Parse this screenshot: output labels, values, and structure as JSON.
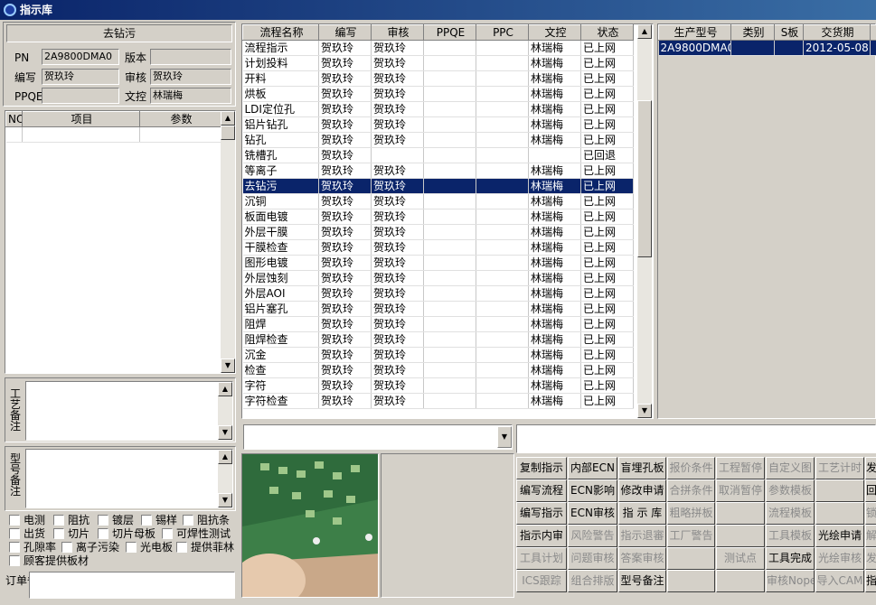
{
  "window": {
    "title": "指示库"
  },
  "header": {
    "process_name": "去钻污",
    "pn_label": "PN",
    "pn_value": "2A9800DMA0",
    "version_label": "版本",
    "version_value": "",
    "editor_label": "编写",
    "editor_value": "贺玖玲",
    "reviewer_label": "审核",
    "reviewer_value": "贺玖玲",
    "ppqe_label": "PPQE",
    "ppqe_value": "",
    "doc_label": "文控",
    "doc_value": "林瑞梅"
  },
  "param_table": {
    "columns": [
      "NO",
      "项目",
      "参数"
    ]
  },
  "notes": {
    "craft_label": "工艺备注",
    "model_label": "型号备注",
    "order_label": "订单备注"
  },
  "checkboxes": [
    [
      "电测",
      "阻抗",
      "镀层",
      "锡样",
      "阻抗条"
    ],
    [
      "出货",
      "切片",
      "切片母板",
      "可焊性测试"
    ],
    [
      "孔隙率",
      "离子污染",
      "光电板",
      "提供菲林"
    ],
    [
      "顾客提供板材"
    ]
  ],
  "process_table": {
    "columns": [
      "流程名称",
      "编写",
      "审核",
      "PPQE",
      "PPC",
      "文控",
      "状态"
    ],
    "selected_index": 9,
    "rows": [
      [
        "流程指示",
        "贺玖玲",
        "贺玖玲",
        "",
        "",
        "林瑞梅",
        "已上网"
      ],
      [
        "计划投料",
        "贺玖玲",
        "贺玖玲",
        "",
        "",
        "林瑞梅",
        "已上网"
      ],
      [
        "开料",
        "贺玖玲",
        "贺玖玲",
        "",
        "",
        "林瑞梅",
        "已上网"
      ],
      [
        "烘板",
        "贺玖玲",
        "贺玖玲",
        "",
        "",
        "林瑞梅",
        "已上网"
      ],
      [
        "LDI定位孔",
        "贺玖玲",
        "贺玖玲",
        "",
        "",
        "林瑞梅",
        "已上网"
      ],
      [
        "铝片钻孔",
        "贺玖玲",
        "贺玖玲",
        "",
        "",
        "林瑞梅",
        "已上网"
      ],
      [
        "钻孔",
        "贺玖玲",
        "贺玖玲",
        "",
        "",
        "林瑞梅",
        "已上网"
      ],
      [
        "铣槽孔",
        "贺玖玲",
        "",
        "",
        "",
        "",
        "已回退"
      ],
      [
        "等离子",
        "贺玖玲",
        "贺玖玲",
        "",
        "",
        "林瑞梅",
        "已上网"
      ],
      [
        "去钻污",
        "贺玖玲",
        "贺玖玲",
        "",
        "",
        "林瑞梅",
        "已上网"
      ],
      [
        "沉铜",
        "贺玖玲",
        "贺玖玲",
        "",
        "",
        "林瑞梅",
        "已上网"
      ],
      [
        "板面电镀",
        "贺玖玲",
        "贺玖玲",
        "",
        "",
        "林瑞梅",
        "已上网"
      ],
      [
        "外层干膜",
        "贺玖玲",
        "贺玖玲",
        "",
        "",
        "林瑞梅",
        "已上网"
      ],
      [
        "干膜检查",
        "贺玖玲",
        "贺玖玲",
        "",
        "",
        "林瑞梅",
        "已上网"
      ],
      [
        "图形电镀",
        "贺玖玲",
        "贺玖玲",
        "",
        "",
        "林瑞梅",
        "已上网"
      ],
      [
        "外层蚀刻",
        "贺玖玲",
        "贺玖玲",
        "",
        "",
        "林瑞梅",
        "已上网"
      ],
      [
        "外层AOI",
        "贺玖玲",
        "贺玖玲",
        "",
        "",
        "林瑞梅",
        "已上网"
      ],
      [
        "铝片塞孔",
        "贺玖玲",
        "贺玖玲",
        "",
        "",
        "林瑞梅",
        "已上网"
      ],
      [
        "阻焊",
        "贺玖玲",
        "贺玖玲",
        "",
        "",
        "林瑞梅",
        "已上网"
      ],
      [
        "阻焊检查",
        "贺玖玲",
        "贺玖玲",
        "",
        "",
        "林瑞梅",
        "已上网"
      ],
      [
        "沉金",
        "贺玖玲",
        "贺玖玲",
        "",
        "",
        "林瑞梅",
        "已上网"
      ],
      [
        "检查",
        "贺玖玲",
        "贺玖玲",
        "",
        "",
        "林瑞梅",
        "已上网"
      ],
      [
        "字符",
        "贺玖玲",
        "贺玖玲",
        "",
        "",
        "林瑞梅",
        "已上网"
      ],
      [
        "字符检查",
        "贺玖玲",
        "贺玖玲",
        "",
        "",
        "林瑞梅",
        "已上网"
      ]
    ]
  },
  "product_table": {
    "columns": [
      "生产型号",
      "类别",
      "S板",
      "交货期",
      "客"
    ],
    "rows": [
      [
        "2A9800DMA0",
        "",
        "",
        "2012-05-08",
        ""
      ]
    ]
  },
  "buttons": [
    [
      "复制指示",
      "内部ECN",
      "盲埋孔板",
      "报价条件",
      "工程暂停",
      "自定义图",
      "工艺计时",
      "发"
    ],
    [
      "编写流程",
      "ECN影响",
      "修改申请",
      "合拼条件",
      "取消暂停",
      "参数模板",
      "",
      "回"
    ],
    [
      "编写指示",
      "ECN审核",
      "指 示 库",
      "粗略拼板",
      "",
      "流程模板",
      "",
      "锁"
    ],
    [
      "指示内审",
      "风险警告",
      "指示退審",
      "工厂警告",
      "",
      "工具模板",
      "光绘申请",
      "解"
    ],
    [
      "工具计划",
      "问题审核",
      "答案审核",
      "",
      "测试点",
      "工具完成",
      "光绘审核",
      "发"
    ],
    [
      "ICS跟踪",
      "组合排版",
      "型号备注",
      "",
      "",
      "审核Nope",
      "导入CAM",
      "指"
    ]
  ],
  "buttons_disabled": [
    [
      false,
      false,
      false,
      true,
      true,
      true,
      true,
      false
    ],
    [
      false,
      false,
      false,
      true,
      true,
      true,
      true,
      false
    ],
    [
      false,
      false,
      false,
      true,
      true,
      true,
      true,
      true
    ],
    [
      false,
      true,
      true,
      true,
      true,
      true,
      false,
      true
    ],
    [
      true,
      true,
      true,
      true,
      true,
      false,
      true,
      true
    ],
    [
      true,
      true,
      false,
      true,
      true,
      true,
      true,
      false
    ]
  ]
}
